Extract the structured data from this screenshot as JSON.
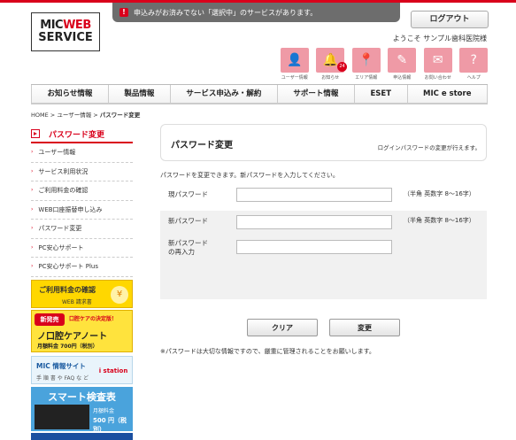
{
  "header": {
    "logo_line1_a": "MIC",
    "logo_line1_b": "WEB",
    "logo_line2": "SERVICE",
    "alert_icon": "!",
    "alert_text": "申込みがお済みでない「選択中」のサービスがあります。",
    "logout_label": "ログアウト",
    "welcome_text": "ようこそ サンプル歯科医院様",
    "icons": [
      {
        "name": "user-info-icon",
        "glyph": "👤",
        "label": "ユーザー情報"
      },
      {
        "name": "notice-icon",
        "glyph": "🔔",
        "label": "お知らせ",
        "badge": "24"
      },
      {
        "name": "area-info-icon",
        "glyph": "📍",
        "label": "エリア情報"
      },
      {
        "name": "application-info-icon",
        "glyph": "✎",
        "label": "申込情報"
      },
      {
        "name": "inquiry-icon",
        "glyph": "✉",
        "label": "お問い合わせ"
      },
      {
        "name": "help-icon",
        "glyph": "?",
        "label": "ヘルプ"
      }
    ]
  },
  "nav": [
    "お知らせ情報",
    "製品情報",
    "サービス申込み・解約",
    "サポート情報",
    "ESET",
    "MIC e store"
  ],
  "breadcrumb": {
    "home": "HOME",
    "sep1": " > ",
    "parent": "ユーザー情報",
    "sep2": " > ",
    "current": "パスワード変更"
  },
  "sidebar": {
    "title": "パスワード変更",
    "items": [
      "ユーザー情報",
      "サービス利用状況",
      "ご利用料金の確認",
      "WEB口座振替申し込み",
      "パスワード変更",
      "PC安心サポート",
      "PC安心サポート Plus"
    ]
  },
  "banners": {
    "fee": {
      "title": "ご利用料金の確認",
      "sub": "WEB 請求書",
      "icon": "¥"
    },
    "oral": {
      "tag": "新発売",
      "catch": "口腔ケアの決定版！",
      "title": "ノ口腔ケアノート",
      "price": "月額料金 700円（税別）"
    },
    "micinfo": {
      "title": "MIC 情報サイト",
      "sub": "手 順 書 や FAQ な ど",
      "logo": "i station"
    },
    "smart": {
      "title": "スマート検査表",
      "sub": "月額料金",
      "price": "500 円（税別）"
    }
  },
  "main": {
    "heading": "パスワード変更",
    "subheading": "ログインパスワードの変更が行えます。",
    "intro": "パスワードを変更できます。新パスワードを入力してください。",
    "fields": [
      {
        "label": "現パスワード",
        "value": "",
        "hint": ""
      },
      {
        "label": "新パスワード",
        "value": "",
        "hint": "（半角 英数字 8～16字）"
      },
      {
        "label_line1": "新パスワード",
        "label_line2": "の再入力",
        "value": ""
      }
    ],
    "hint_top": "（半角 英数字 8～16字）",
    "clear_label": "クリア",
    "submit_label": "変更",
    "note": "※パスワードは大切な情報ですので、厳重に管理されることをお願いします。"
  },
  "colors": {
    "accent": "#d9001b",
    "icon_pink": "#ef9aa6",
    "banner_yellow": "#ffd700",
    "banner_blue": "#4aa3dc"
  }
}
